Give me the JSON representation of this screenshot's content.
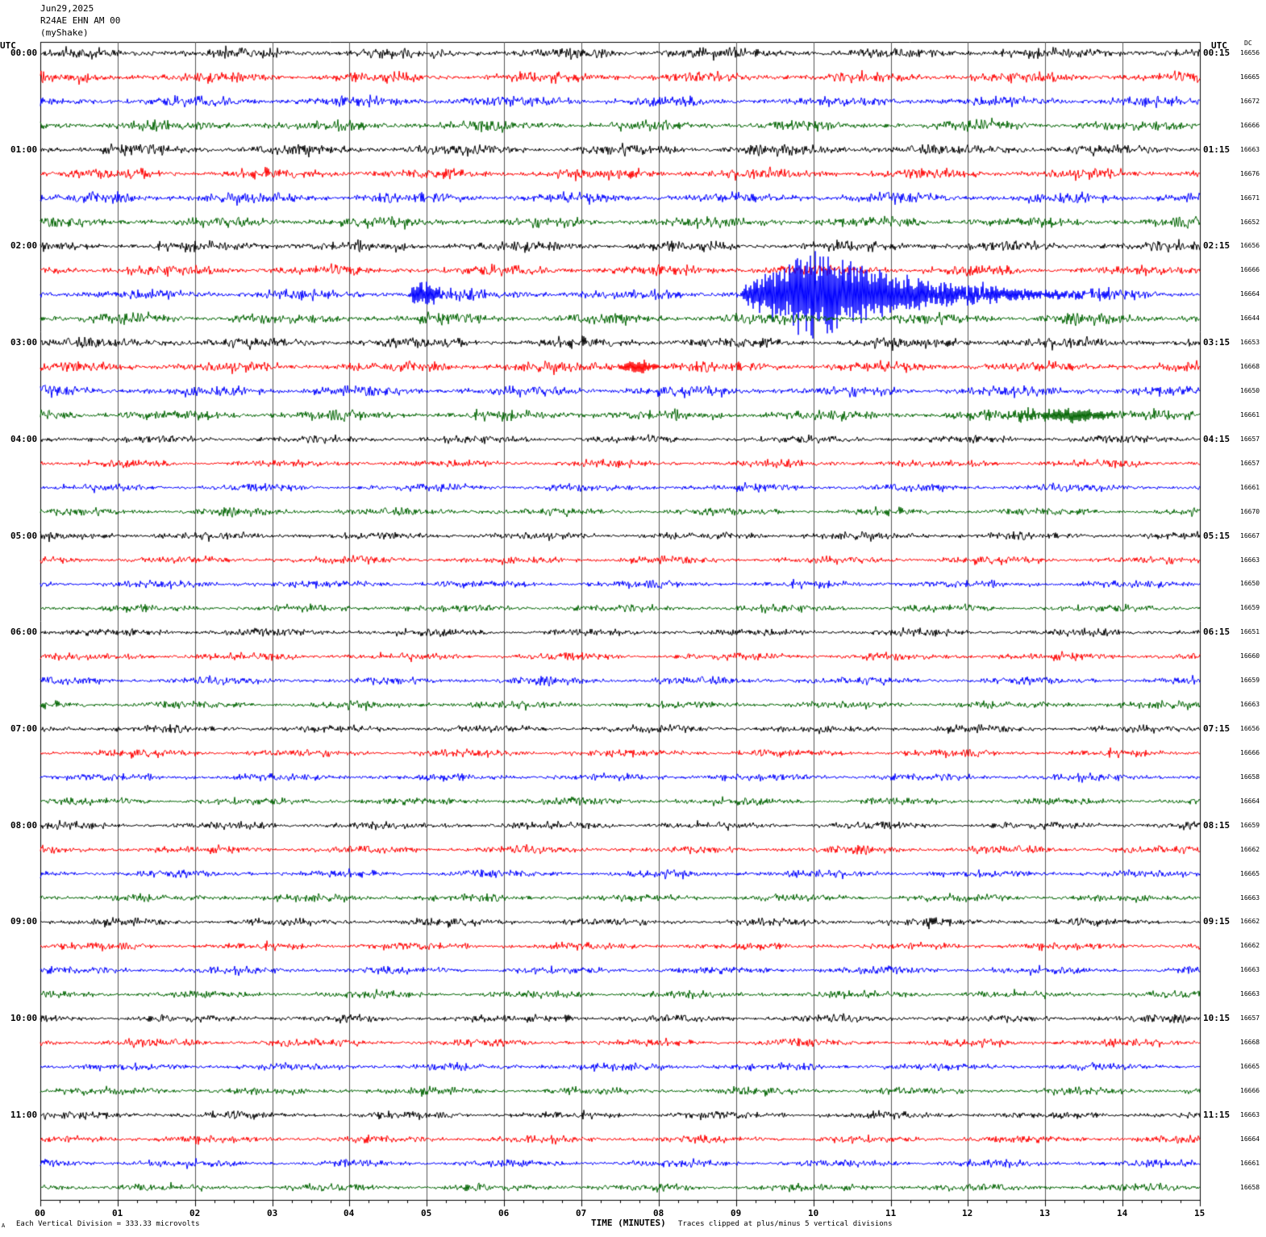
{
  "header": {
    "date": "Jun29,2025",
    "station": "R24AE EHN AM 00",
    "network": "(myShake)"
  },
  "left_axis_label": "UTC",
  "right_axis_label": "UTC",
  "dc_label": "DC",
  "footer": {
    "scale_note": "Each Vertical Division =  333.33 microvolts",
    "clip_note": "Traces clipped at plus/minus 5 vertical divisions",
    "corner_mark": "A"
  },
  "colors": {
    "cycle": [
      "#000000",
      "#ff0000",
      "#0000ff",
      "#006400"
    ],
    "grid": "#000000"
  },
  "chart_data": {
    "type": "helicorder",
    "xlabel": "TIME (MINUTES)",
    "xlim": [
      0,
      15
    ],
    "x_ticks": [
      "00",
      "01",
      "02",
      "03",
      "04",
      "05",
      "06",
      "07",
      "08",
      "09",
      "10",
      "11",
      "12",
      "13",
      "14",
      "15"
    ],
    "left_hour_labels": [
      "00:00",
      "01:00",
      "02:00",
      "03:00",
      "04:00",
      "05:00",
      "06:00",
      "07:00",
      "08:00",
      "09:00",
      "10:00",
      "11:00"
    ],
    "right_hour_labels": [
      "00:15",
      "01:15",
      "02:15",
      "03:15",
      "04:15",
      "05:15",
      "06:15",
      "07:15",
      "08:15",
      "09:15",
      "10:15",
      "11:15"
    ],
    "dc_values": [
      "16656",
      "16665",
      "16672",
      "16666",
      "16663",
      "16676",
      "16671",
      "16652",
      "16656",
      "16666",
      "16664",
      "16644",
      "16653",
      "16668",
      "16650",
      "16661",
      "16657",
      "16657",
      "16661",
      "16670",
      "16667",
      "16663",
      "16650",
      "16659",
      "16651",
      "16660",
      "16659",
      "16663",
      "16656",
      "16666",
      "16658",
      "16664",
      "16659",
      "16662",
      "16665",
      "16663",
      "16662",
      "16662",
      "16663",
      "16663",
      "16657",
      "16668",
      "16665",
      "16666",
      "16663",
      "16664",
      "16661",
      "16658"
    ],
    "events": [
      {
        "row": 10,
        "start_min": 4.75,
        "end_min": 5.6,
        "peak_min": 4.95,
        "amp_div": 1.6
      },
      {
        "row": 10,
        "start_min": 9.05,
        "end_min": 13.9,
        "peak_min": 10.1,
        "amp_div": 5
      },
      {
        "row": 13,
        "start_min": 7.45,
        "end_min": 8.25,
        "peak_min": 7.8,
        "amp_div": 0.8
      },
      {
        "row": 15,
        "start_min": 12.4,
        "end_min": 14.8,
        "peak_min": 13.4,
        "amp_div": 0.8
      },
      {
        "row": 36,
        "start_min": 11.45,
        "end_min": 11.7,
        "peak_min": 11.55,
        "amp_div": 0.5
      },
      {
        "row": 40,
        "start_min": 6.75,
        "end_min": 6.95,
        "peak_min": 6.82,
        "amp_div": 0.5
      }
    ]
  }
}
